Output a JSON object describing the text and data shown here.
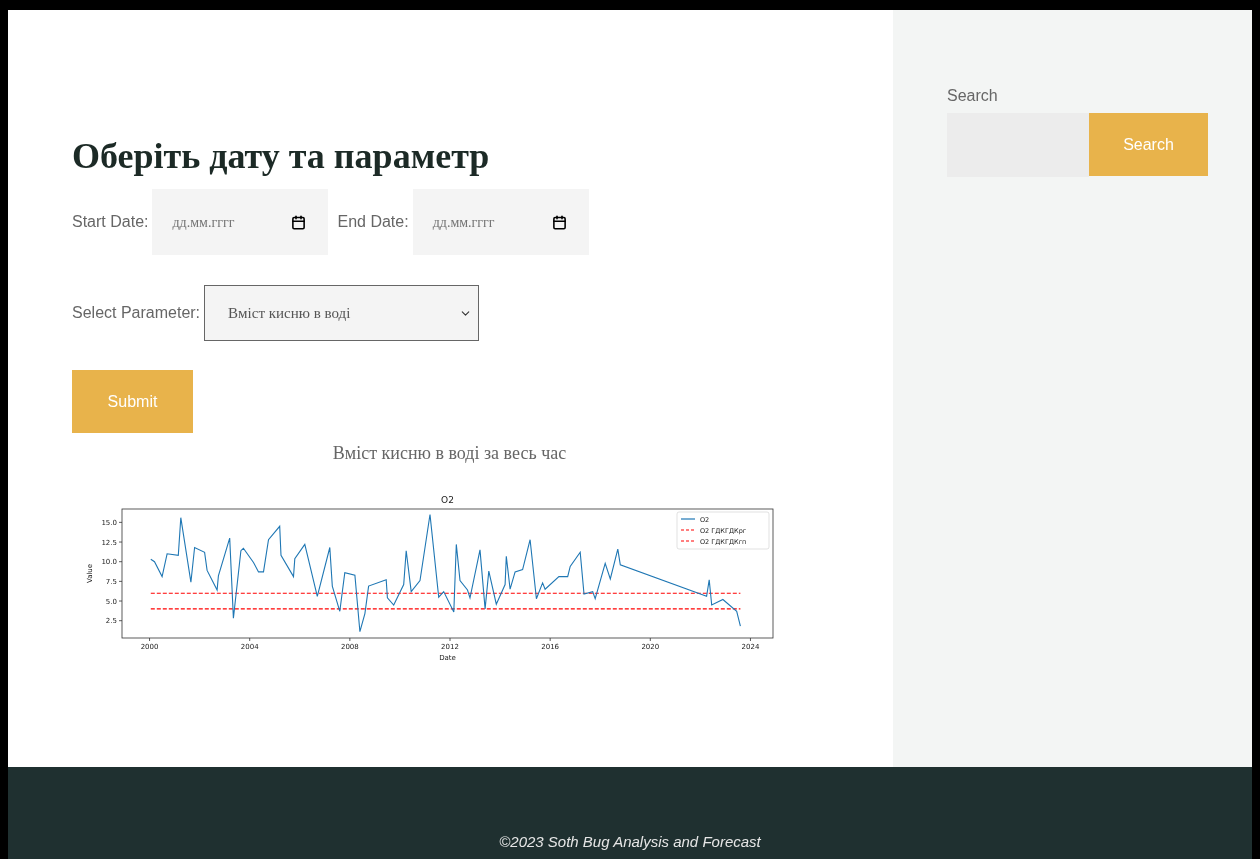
{
  "main": {
    "heading": "Оберіть дату та параметр",
    "start_date": {
      "label": "Start Date:",
      "placeholder": "дд.мм.гггг"
    },
    "end_date": {
      "label": "End Date:",
      "placeholder": "дд.мм.гггг"
    },
    "parameter": {
      "label": "Select Parameter:",
      "value": "Вміст кисню в воді"
    },
    "submit": "Submit",
    "chart_heading": "Вміст кисню в воді за весь час",
    "chart_data": {
      "type": "line",
      "title": "O2",
      "xlabel": "Date",
      "ylabel": "Value",
      "xlim": [
        1998.9,
        2024.9
      ],
      "ylim": [
        0.3,
        16.7
      ],
      "xticks": [
        2000,
        2004,
        2008,
        2012,
        2016,
        2020,
        2024
      ],
      "yticks": [
        {
          "value": 2.5,
          "label": "2.5"
        },
        {
          "value": 5,
          "label": "5.0"
        },
        {
          "value": 7.5,
          "label": "7.5"
        },
        {
          "value": 10,
          "label": "10.0"
        },
        {
          "value": 12.5,
          "label": "12.5"
        },
        {
          "value": 15,
          "label": "15.0"
        }
      ],
      "x": [
        2000.05,
        2000.2,
        2000.5,
        2000.7,
        2001.15,
        2001.25,
        2001.65,
        2001.8,
        2002.2,
        2002.3,
        2002.7,
        2002.75,
        2003.2,
        2003.35,
        2003.65,
        2003.75,
        2004.15,
        2004.35,
        2004.55,
        2004.75,
        2005.2,
        2005.25,
        2005.75,
        2005.8,
        2006.2,
        2006.7,
        2007.2,
        2007.3,
        2007.6,
        2007.8,
        2008.2,
        2008.4,
        2008.6,
        2008.75,
        2009.45,
        2009.5,
        2009.75,
        2010.15,
        2010.25,
        2010.45,
        2010.8,
        2011.2,
        2011.55,
        2011.75,
        2012.15,
        2012.25,
        2012.4,
        2012.7,
        2012.8,
        2013.2,
        2013.4,
        2013.55,
        2013.85,
        2014.2,
        2014.25,
        2014.4,
        2014.6,
        2014.9,
        2015.2,
        2015.45,
        2015.7,
        2015.8,
        2016.35,
        2016.7,
        2016.8,
        2017.2,
        2017.35,
        2017.7,
        2017.8,
        2018.2,
        2018.4,
        2018.7,
        2018.8,
        2022.25,
        2022.35,
        2022.45,
        2022.9,
        2023.45,
        2023.6
      ],
      "series": [
        {
          "name": "O2",
          "color": "#1f77b4",
          "values": [
            10.3,
            10.0,
            8.1,
            11.0,
            10.8,
            15.6,
            7.4,
            11.8,
            11.2,
            8.9,
            6.4,
            8.2,
            13.0,
            2.8,
            11.4,
            11.7,
            9.9,
            8.7,
            8.7,
            12.8,
            14.5,
            10.8,
            8.1,
            10.4,
            12.2,
            5.6,
            11.8,
            6.9,
            3.7,
            8.6,
            8.3,
            1.1,
            3.4,
            6.9,
            7.7,
            5.4,
            4.5,
            7.1,
            11.4,
            6.2,
            7.6,
            16.0,
            5.5,
            6.2,
            3.6,
            12.2,
            7.6,
            6.4,
            5.4,
            11.5,
            4.0,
            8.8,
            4.6,
            7.1,
            10.7,
            6.5,
            8.7,
            9.0,
            12.8,
            5.3,
            7.3,
            6.5,
            8.1,
            8.1,
            9.4,
            11.2,
            5.9,
            6.2,
            5.3,
            9.8,
            7.8,
            11.6,
            9.6,
            5.6,
            7.7,
            4.5,
            5.2,
            3.7,
            1.8
          ]
        },
        {
          "name": "O2 ГДКГДКрг",
          "color": "#ff0000",
          "line_style": "dashed",
          "values": [
            6,
            6,
            6,
            6,
            6,
            6,
            6,
            6,
            6,
            6,
            6,
            6,
            6,
            6,
            6,
            6,
            6,
            6,
            6,
            6,
            6,
            6,
            6,
            6,
            6,
            6,
            6,
            6,
            6,
            6,
            6,
            6,
            6,
            6,
            6,
            6,
            6,
            6,
            6,
            6,
            6,
            6,
            6,
            6,
            6,
            6,
            6,
            6,
            6,
            6,
            6,
            6,
            6,
            6,
            6,
            6,
            6,
            6,
            6,
            6,
            6,
            6,
            6,
            6,
            6,
            6,
            6,
            6,
            6,
            6,
            6,
            6,
            6,
            6,
            6,
            6,
            6,
            6,
            6
          ]
        },
        {
          "name": "O2 ГДКГДКгп",
          "color": "#ff0000",
          "line_style": "dashed",
          "values": [
            4,
            4,
            4,
            4,
            4,
            4,
            4,
            4,
            4,
            4,
            4,
            4,
            4,
            4,
            4,
            4,
            4,
            4,
            4,
            4,
            4,
            4,
            4,
            4,
            4,
            4,
            4,
            4,
            4,
            4,
            4,
            4,
            4,
            4,
            4,
            4,
            4,
            4,
            4,
            4,
            4,
            4,
            4,
            4,
            4,
            4,
            4,
            4,
            4,
            4,
            4,
            4,
            4,
            4,
            4,
            4,
            4,
            4,
            4,
            4,
            4,
            4,
            4,
            4,
            4,
            4,
            4,
            4,
            4,
            4,
            4,
            4,
            4,
            4,
            4,
            4,
            4,
            4,
            4
          ]
        }
      ],
      "stacked": false,
      "legend": "upper right"
    }
  },
  "sidebar": {
    "search_label": "Search",
    "search_button": "Search"
  },
  "footer": {
    "text": "©2023 Soth Bug Analysis and Forecast"
  }
}
